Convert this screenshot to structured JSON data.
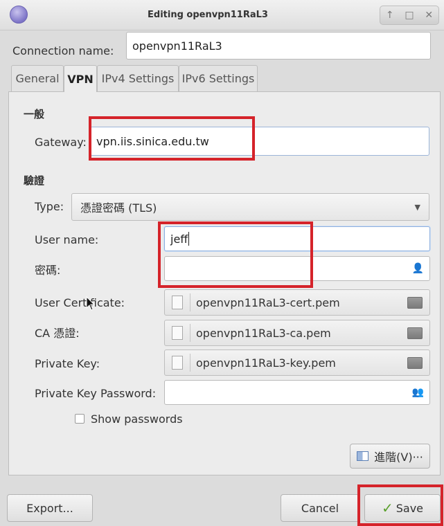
{
  "window": {
    "title": "Editing openvpn11RaL3",
    "controls": [
      "↑",
      "□",
      "✕"
    ]
  },
  "connection": {
    "label": "Connection name:",
    "value": "openvpn11RaL3"
  },
  "tabs": [
    {
      "label": "General"
    },
    {
      "label": "VPN"
    },
    {
      "label": "IPv4 Settings"
    },
    {
      "label": "IPv6 Settings"
    }
  ],
  "vpn": {
    "general_heading": "一般",
    "gateway": {
      "label": "Gateway:",
      "value": "vpn.iis.sinica.edu.tw"
    },
    "auth_heading": "驗證",
    "type": {
      "label": "Type:",
      "value": "憑證密碼 (TLS)"
    },
    "username": {
      "label": "User name:",
      "value": "jeff"
    },
    "password": {
      "label": "密碼:",
      "value": ""
    },
    "user_cert": {
      "label": "User Certificate:",
      "value": "openvpn11RaL3-cert.pem"
    },
    "ca_cert": {
      "label": "CA 憑證:",
      "value": "openvpn11RaL3-ca.pem"
    },
    "private_key": {
      "label": "Private Key:",
      "value": "openvpn11RaL3-key.pem"
    },
    "private_key_password": {
      "label": "Private Key Password:",
      "value": ""
    },
    "show_passwords": {
      "label": "Show passwords",
      "checked": false
    },
    "advanced_label": "進階(V)···"
  },
  "buttons": {
    "export": "Export...",
    "cancel": "Cancel",
    "save": "Save"
  },
  "colors": {
    "highlight": "#d5232a",
    "save_check": "#5aa02c"
  }
}
